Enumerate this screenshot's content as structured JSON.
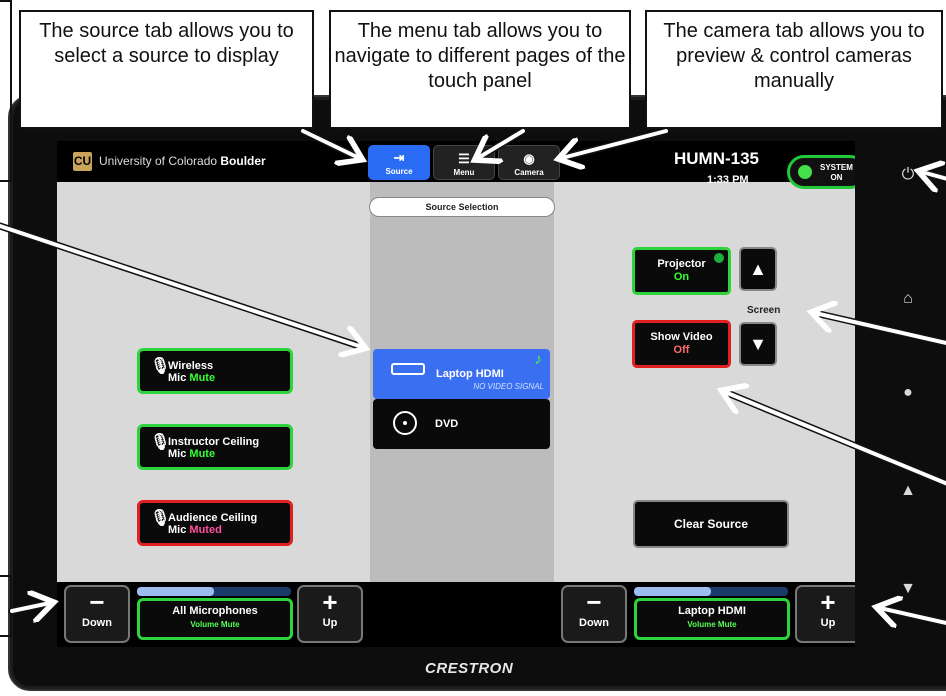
{
  "callouts": {
    "source_tab": "The source tab allows you to select a source to display",
    "menu_tab": "The menu tab allows you to navigate to different pages of the touch panel",
    "camera_tab": "The camera tab allows you to preview & control cameras manually"
  },
  "header": {
    "logo_text": "CU",
    "university": "University of Colorado ",
    "university_bold": "Boulder",
    "tabs": [
      {
        "label": "Source",
        "icon": "monitor-in-icon",
        "active": true
      },
      {
        "label": "Menu",
        "icon": "menu-icon",
        "active": false
      },
      {
        "label": "Camera",
        "icon": "camera-icon",
        "active": false
      }
    ],
    "room": "HUMN-135",
    "time": "1:33 PM",
    "system_line1": "SYSTEM",
    "system_line2": "ON"
  },
  "source_panel": {
    "title": "Source Selection",
    "sources": [
      {
        "label": "Laptop HDMI",
        "sub": "NO VIDEO SIGNAL",
        "selected": true
      },
      {
        "label": "DVD",
        "sub": "",
        "selected": false
      }
    ]
  },
  "mics": [
    {
      "line1": "Wireless",
      "line2a": "Mic ",
      "line2b": "Mute",
      "state": "unmuted"
    },
    {
      "line1": "Instructor Ceiling",
      "line2a": "Mic ",
      "line2b": "Mute",
      "state": "unmuted"
    },
    {
      "line1": "Audience Ceiling",
      "line2a": "Mic ",
      "line2b": "Muted",
      "state": "muted"
    }
  ],
  "right_controls": {
    "projector": "Projector",
    "projector_state": "On",
    "show_video": "Show Video",
    "show_video_state": "Off",
    "screen_label": "Screen",
    "up_arrow": "▲",
    "down_arrow": "▼",
    "clear_source": "Clear Source"
  },
  "footer": {
    "left": {
      "down": "Down",
      "up": "Up",
      "name": "All Microphones",
      "sub": "Volume Mute",
      "level": 0.5
    },
    "right": {
      "down": "Down",
      "up": "Up",
      "name": "Laptop HDMI",
      "sub": "Volume Mute",
      "level": 0.5
    },
    "minus": "−",
    "plus": "+"
  },
  "side_buttons": [
    "power-icon",
    "home-icon",
    "lightbulb-icon",
    "volume-up-icon",
    "volume-down-icon"
  ],
  "brand": "CRESTRON"
}
